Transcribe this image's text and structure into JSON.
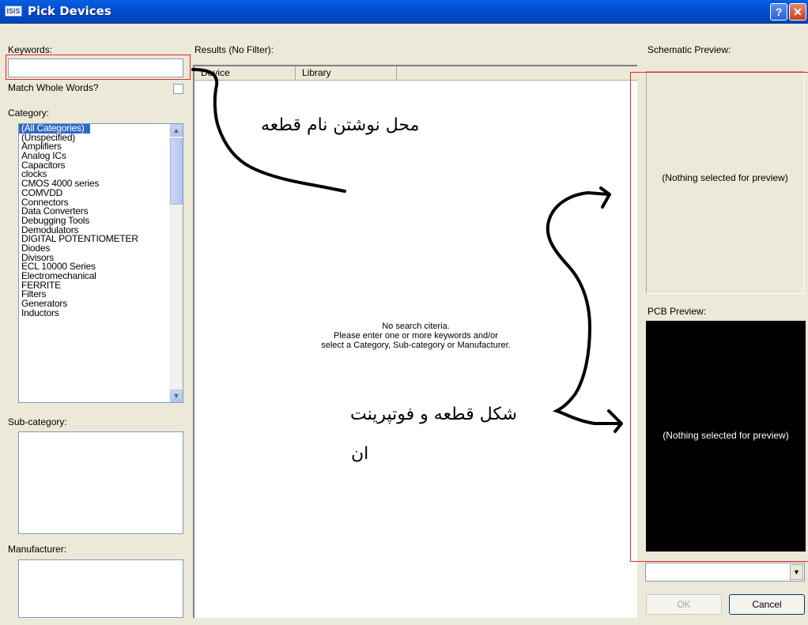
{
  "window": {
    "title": "Pick Devices",
    "app_icon_text": "ISIS",
    "help_label": "?",
    "close_label": "✕"
  },
  "left": {
    "keywords_label": "Keywords:",
    "keywords_value": "",
    "match_whole_words_label": "Match Whole Words?",
    "category_label": "Category:",
    "categories": [
      "(All Categories)",
      "(Unspecified)",
      "Amplifiers",
      "Analog ICs",
      "Capacitors",
      "clocks",
      "CMOS 4000 series",
      "COMVDD",
      "Connectors",
      "Data Converters",
      "Debugging Tools",
      "Demodulators",
      "DIGITAL POTENTIOMETER",
      "Diodes",
      "Divisors",
      "ECL 10000 Series",
      "Electromechanical",
      "FERRITE",
      "Filters",
      "Generators",
      "Inductors"
    ],
    "selected_category_index": 0,
    "subcategory_label": "Sub-category:",
    "manufacturer_label": "Manufacturer:"
  },
  "results": {
    "label": "Results (No Filter):",
    "columns": [
      "Device",
      "Library",
      ""
    ],
    "empty_line1": "No search citeria.",
    "empty_line2": "Please enter one or more keywords and/or",
    "empty_line3": "select a Category, Sub-category or Manufacturer."
  },
  "right": {
    "schematic_label": "Schematic Preview:",
    "schematic_empty": "(Nothing selected for preview)",
    "pcb_label": "PCB Preview:",
    "pcb_empty": "(Nothing selected for preview)",
    "package_value": "",
    "ok_label": "OK",
    "cancel_label": "Cancel"
  },
  "annotations": {
    "keyword_note": "محل نوشتن نام قطعه",
    "preview_note_line1": "شکل قطعه و فوتپرینت",
    "preview_note_line2": "ان"
  },
  "colors": {
    "selection": "#316ac5",
    "annotation_box": "#e0282a",
    "titlebar": "#0151d6",
    "pcb_background": "#000000"
  }
}
